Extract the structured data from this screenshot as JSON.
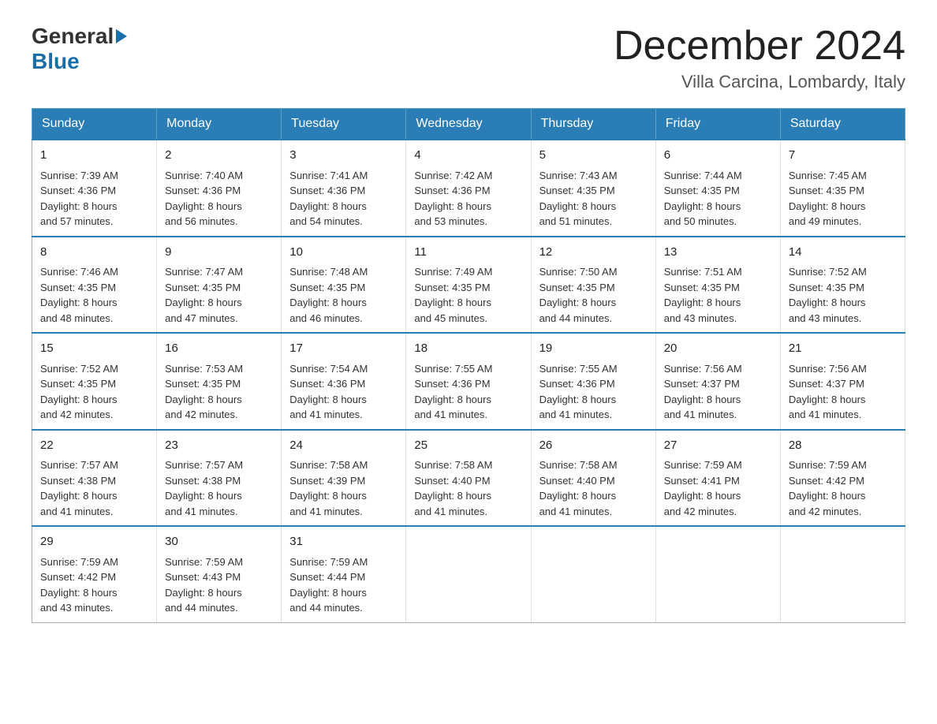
{
  "logo": {
    "general": "General",
    "blue": "Blue"
  },
  "header": {
    "month": "December 2024",
    "location": "Villa Carcina, Lombardy, Italy"
  },
  "weekdays": [
    "Sunday",
    "Monday",
    "Tuesday",
    "Wednesday",
    "Thursday",
    "Friday",
    "Saturday"
  ],
  "weeks": [
    [
      {
        "day": "1",
        "sunrise": "7:39 AM",
        "sunset": "4:36 PM",
        "daylight": "8 hours and 57 minutes."
      },
      {
        "day": "2",
        "sunrise": "7:40 AM",
        "sunset": "4:36 PM",
        "daylight": "8 hours and 56 minutes."
      },
      {
        "day": "3",
        "sunrise": "7:41 AM",
        "sunset": "4:36 PM",
        "daylight": "8 hours and 54 minutes."
      },
      {
        "day": "4",
        "sunrise": "7:42 AM",
        "sunset": "4:36 PM",
        "daylight": "8 hours and 53 minutes."
      },
      {
        "day": "5",
        "sunrise": "7:43 AM",
        "sunset": "4:35 PM",
        "daylight": "8 hours and 51 minutes."
      },
      {
        "day": "6",
        "sunrise": "7:44 AM",
        "sunset": "4:35 PM",
        "daylight": "8 hours and 50 minutes."
      },
      {
        "day": "7",
        "sunrise": "7:45 AM",
        "sunset": "4:35 PM",
        "daylight": "8 hours and 49 minutes."
      }
    ],
    [
      {
        "day": "8",
        "sunrise": "7:46 AM",
        "sunset": "4:35 PM",
        "daylight": "8 hours and 48 minutes."
      },
      {
        "day": "9",
        "sunrise": "7:47 AM",
        "sunset": "4:35 PM",
        "daylight": "8 hours and 47 minutes."
      },
      {
        "day": "10",
        "sunrise": "7:48 AM",
        "sunset": "4:35 PM",
        "daylight": "8 hours and 46 minutes."
      },
      {
        "day": "11",
        "sunrise": "7:49 AM",
        "sunset": "4:35 PM",
        "daylight": "8 hours and 45 minutes."
      },
      {
        "day": "12",
        "sunrise": "7:50 AM",
        "sunset": "4:35 PM",
        "daylight": "8 hours and 44 minutes."
      },
      {
        "day": "13",
        "sunrise": "7:51 AM",
        "sunset": "4:35 PM",
        "daylight": "8 hours and 43 minutes."
      },
      {
        "day": "14",
        "sunrise": "7:52 AM",
        "sunset": "4:35 PM",
        "daylight": "8 hours and 43 minutes."
      }
    ],
    [
      {
        "day": "15",
        "sunrise": "7:52 AM",
        "sunset": "4:35 PM",
        "daylight": "8 hours and 42 minutes."
      },
      {
        "day": "16",
        "sunrise": "7:53 AM",
        "sunset": "4:35 PM",
        "daylight": "8 hours and 42 minutes."
      },
      {
        "day": "17",
        "sunrise": "7:54 AM",
        "sunset": "4:36 PM",
        "daylight": "8 hours and 41 minutes."
      },
      {
        "day": "18",
        "sunrise": "7:55 AM",
        "sunset": "4:36 PM",
        "daylight": "8 hours and 41 minutes."
      },
      {
        "day": "19",
        "sunrise": "7:55 AM",
        "sunset": "4:36 PM",
        "daylight": "8 hours and 41 minutes."
      },
      {
        "day": "20",
        "sunrise": "7:56 AM",
        "sunset": "4:37 PM",
        "daylight": "8 hours and 41 minutes."
      },
      {
        "day": "21",
        "sunrise": "7:56 AM",
        "sunset": "4:37 PM",
        "daylight": "8 hours and 41 minutes."
      }
    ],
    [
      {
        "day": "22",
        "sunrise": "7:57 AM",
        "sunset": "4:38 PM",
        "daylight": "8 hours and 41 minutes."
      },
      {
        "day": "23",
        "sunrise": "7:57 AM",
        "sunset": "4:38 PM",
        "daylight": "8 hours and 41 minutes."
      },
      {
        "day": "24",
        "sunrise": "7:58 AM",
        "sunset": "4:39 PM",
        "daylight": "8 hours and 41 minutes."
      },
      {
        "day": "25",
        "sunrise": "7:58 AM",
        "sunset": "4:40 PM",
        "daylight": "8 hours and 41 minutes."
      },
      {
        "day": "26",
        "sunrise": "7:58 AM",
        "sunset": "4:40 PM",
        "daylight": "8 hours and 41 minutes."
      },
      {
        "day": "27",
        "sunrise": "7:59 AM",
        "sunset": "4:41 PM",
        "daylight": "8 hours and 42 minutes."
      },
      {
        "day": "28",
        "sunrise": "7:59 AM",
        "sunset": "4:42 PM",
        "daylight": "8 hours and 42 minutes."
      }
    ],
    [
      {
        "day": "29",
        "sunrise": "7:59 AM",
        "sunset": "4:42 PM",
        "daylight": "8 hours and 43 minutes."
      },
      {
        "day": "30",
        "sunrise": "7:59 AM",
        "sunset": "4:43 PM",
        "daylight": "8 hours and 44 minutes."
      },
      {
        "day": "31",
        "sunrise": "7:59 AM",
        "sunset": "4:44 PM",
        "daylight": "8 hours and 44 minutes."
      },
      null,
      null,
      null,
      null
    ]
  ],
  "labels": {
    "sunrise": "Sunrise:",
    "sunset": "Sunset:",
    "daylight": "Daylight:"
  }
}
